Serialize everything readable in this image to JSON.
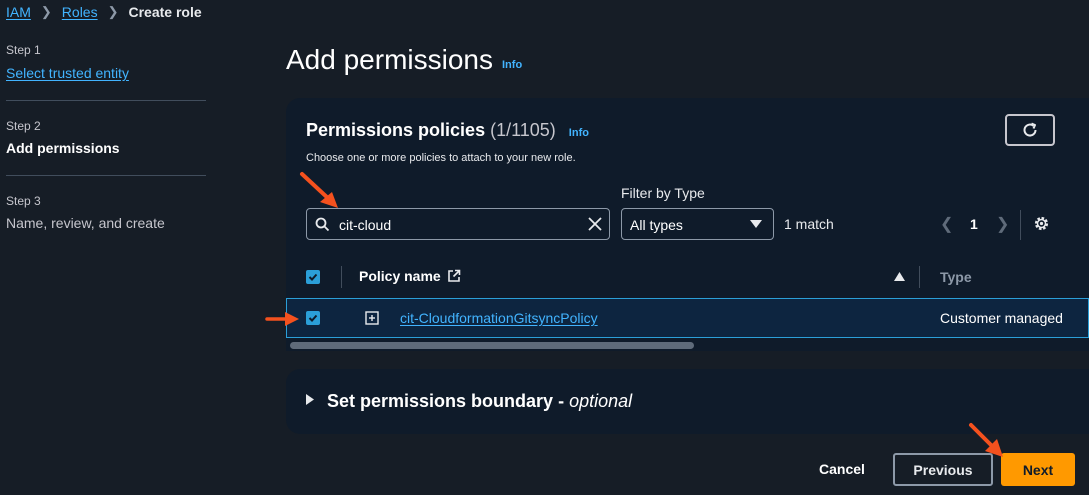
{
  "breadcrumb": {
    "items": [
      "IAM",
      "Roles"
    ],
    "current": "Create role"
  },
  "steps": [
    {
      "label": "Step 1",
      "title": "Select trusted entity"
    },
    {
      "label": "Step 2",
      "title": "Add permissions"
    },
    {
      "label": "Step 3",
      "title": "Name, review, and create"
    }
  ],
  "page": {
    "title": "Add permissions",
    "info": "Info"
  },
  "policies": {
    "title": "Permissions policies",
    "count": "(1/1105)",
    "info": "Info",
    "description": "Choose one or more policies to attach to your new role.",
    "search_value": "cit-cloud",
    "filter_label": "Filter by Type",
    "filter_value": "All types",
    "match_text": "1 match",
    "page_number": "1",
    "columns": {
      "name": "Policy name",
      "type": "Type"
    },
    "rows": [
      {
        "name": "cit-CloudformationGitsyncPolicy",
        "type": "Customer managed",
        "selected": true
      }
    ]
  },
  "boundary": {
    "title": "Set permissions boundary",
    "suffix": "optional",
    "separator": " - "
  },
  "footer": {
    "cancel": "Cancel",
    "previous": "Previous",
    "next": "Next"
  },
  "colors": {
    "accent": "#42b4ff",
    "primary_button": "#ff9900",
    "annotation_arrow": "#f4511e",
    "checkbox": "#2b9fd8"
  }
}
